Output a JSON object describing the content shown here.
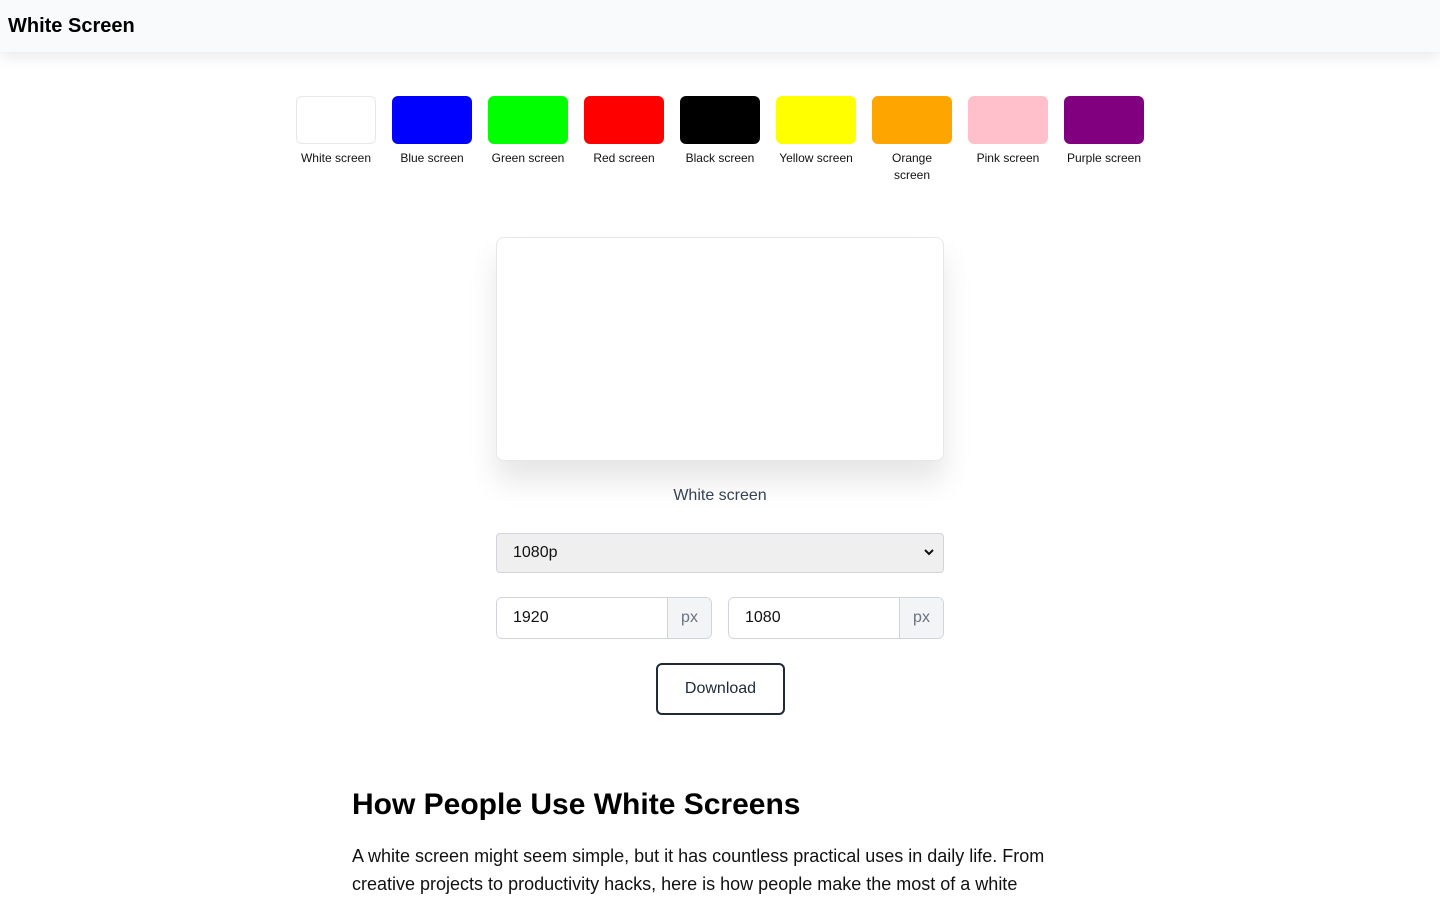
{
  "header": {
    "title": "White Screen"
  },
  "swatches": [
    {
      "label": "White screen",
      "color": "#ffffff"
    },
    {
      "label": "Blue screen",
      "color": "#0000ff"
    },
    {
      "label": "Green screen",
      "color": "#00ff00"
    },
    {
      "label": "Red screen",
      "color": "#ff0000"
    },
    {
      "label": "Black screen",
      "color": "#000000"
    },
    {
      "label": "Yellow screen",
      "color": "#ffff00"
    },
    {
      "label": "Orange screen",
      "color": "#ffa500"
    },
    {
      "label": "Pink screen",
      "color": "#ffc0cb"
    },
    {
      "label": "Purple screen",
      "color": "#800080"
    }
  ],
  "preview": {
    "caption": "White screen",
    "color": "#ffffff"
  },
  "resolution": {
    "selected": "1080p"
  },
  "dimensions": {
    "width": "1920",
    "height": "1080",
    "unit": "px"
  },
  "download": {
    "label": "Download"
  },
  "article": {
    "heading": "How People Use White Screens",
    "intro": "A white screen might seem simple, but it has countless practical uses in daily life. From creative projects to productivity hacks, here is how people make the most of a white"
  }
}
